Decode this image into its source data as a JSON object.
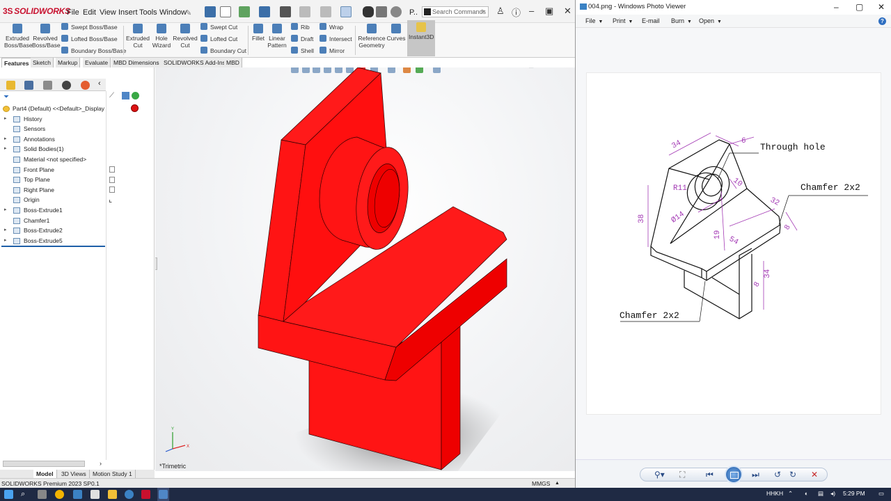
{
  "solidworks": {
    "logo": "SOLIDWORKS",
    "menus": [
      "File",
      "Edit",
      "View",
      "Insert",
      "Tools",
      "Window"
    ],
    "search_placeholder": "Search Commands",
    "ribbon": {
      "extruded_boss": [
        "Extruded",
        "Boss/Base"
      ],
      "revolved_boss": [
        "Revolved",
        "Boss/Base"
      ],
      "swept_boss": "Swept Boss/Base",
      "lofted_boss": "Lofted Boss/Base",
      "boundary_boss": "Boundary Boss/Base",
      "extruded_cut": [
        "Extruded",
        "Cut"
      ],
      "hole_wizard": [
        "Hole",
        "Wizard"
      ],
      "revolved_cut": [
        "Revolved",
        "Cut"
      ],
      "swept_cut": "Swept Cut",
      "lofted_cut": "Lofted Cut",
      "boundary_cut": "Boundary Cut",
      "fillet": "Fillet",
      "linear_pattern": [
        "Linear",
        "Pattern"
      ],
      "rib": "Rib",
      "draft": "Draft",
      "shell": "Shell",
      "wrap": "Wrap",
      "intersect": "Intersect",
      "mirror": "Mirror",
      "reference_geometry": [
        "Reference",
        "Geometry"
      ],
      "curves": "Curves",
      "instant3d": "Instant3D"
    },
    "tabs": [
      "Features",
      "Sketch",
      "Markup",
      "Evaluate",
      "MBD Dimensions",
      "SOLIDWORKS Add-Ins",
      "MBD"
    ],
    "tree": {
      "root": "Part4 (Default) <<Default>_Display State",
      "items": [
        {
          "label": "History",
          "expandable": true
        },
        {
          "label": "Sensors",
          "expandable": false
        },
        {
          "label": "Annotations",
          "expandable": true
        },
        {
          "label": "Solid Bodies(1)",
          "expandable": true
        },
        {
          "label": "Material <not specified>",
          "expandable": false
        },
        {
          "label": "Front Plane",
          "expandable": false
        },
        {
          "label": "Top Plane",
          "expandable": false
        },
        {
          "label": "Right Plane",
          "expandable": false
        },
        {
          "label": "Origin",
          "expandable": false
        },
        {
          "label": "Boss-Extrude1",
          "expandable": true
        },
        {
          "label": "Chamfer1",
          "expandable": false
        },
        {
          "label": "Boss-Extrude2",
          "expandable": true
        },
        {
          "label": "Boss-Extrude5",
          "expandable": true
        }
      ]
    },
    "bottom_tabs": [
      "Model",
      "3D Views",
      "Motion Study 1"
    ],
    "view_label": "*Trimetric",
    "status": "SOLIDWORKS Premium 2023 SP0.1",
    "units": "MMGS",
    "model_color": "#ff0000"
  },
  "photo_viewer": {
    "title": "004.png - Windows Photo Viewer",
    "menu": [
      "File",
      "Print",
      "E-mail",
      "Burn",
      "Open"
    ],
    "menu_has_arrow": [
      true,
      true,
      false,
      true,
      true
    ],
    "drawing": {
      "labels": {
        "through_hole": "Through hole",
        "chamfer_right": "Chamfer 2x2",
        "chamfer_left": "Chamfer 2x2"
      },
      "dims": {
        "d34_top": "34",
        "d6": "6",
        "d10": "10",
        "r11": "R11",
        "d14": "Ø14",
        "d38": "38",
        "d19": "19",
        "d54": "54",
        "d32": "32",
        "d8_right": "8",
        "d8_lower": "8",
        "d34_lower": "34"
      },
      "dim_color": "#a43bb5"
    }
  },
  "taskbar": {
    "lang": "HHKH",
    "time": "5:29 PM"
  }
}
